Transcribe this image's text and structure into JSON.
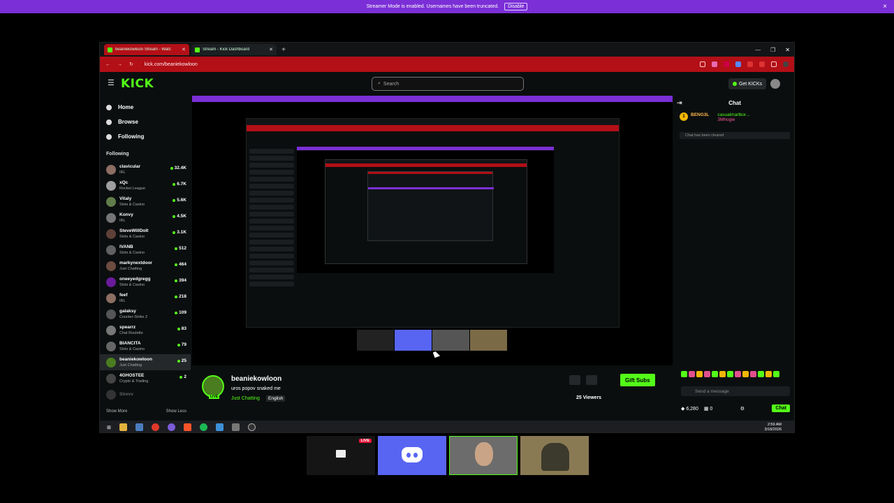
{
  "banner": {
    "text": "Streamer Mode is enabled. Usernames have been truncated.",
    "disable_label": "Disable",
    "close_icon": "×"
  },
  "browser": {
    "tabs": [
      {
        "label": "beaniekowloon Stream - Watc",
        "active": true
      },
      {
        "label": "Stream - Kick Dashboard",
        "active": false
      }
    ],
    "new_tab": "+",
    "url": "kick.com/beaniekowloon",
    "winctl": {
      "min": "—",
      "max": "❐",
      "close": "✕"
    }
  },
  "kick": {
    "logo": "KICK",
    "search_placeholder": "Search",
    "get_kicks": "Get KICKs",
    "nav": [
      {
        "label": "Home",
        "icon": "home-icon"
      },
      {
        "label": "Browse",
        "icon": "compass-icon"
      },
      {
        "label": "Following",
        "icon": "heart-icon"
      }
    ],
    "following_header": "Following",
    "following": [
      {
        "name": "clavicular",
        "cat": "IRL",
        "viewers": "32.4K",
        "color": "#8d6e63"
      },
      {
        "name": "xQc",
        "cat": "Rocket League",
        "viewers": "6.7K",
        "color": "#9e9e9e"
      },
      {
        "name": "Vitaly",
        "cat": "Slots & Casino",
        "viewers": "5.6K",
        "color": "#607d4b"
      },
      {
        "name": "Konvy",
        "cat": "IRL",
        "viewers": "4.5K",
        "color": "#757575"
      },
      {
        "name": "SteveWillDoIt",
        "cat": "Slots & Casino",
        "viewers": "3.1K",
        "color": "#5d4037"
      },
      {
        "name": "IVANB",
        "cat": "Slots & Casino",
        "viewers": "512",
        "color": "#616161"
      },
      {
        "name": "markynextdoor",
        "cat": "Just Chatting",
        "viewers": "464",
        "color": "#6d4c41"
      },
      {
        "name": "oneeyedgregg",
        "cat": "Slots & Casino",
        "viewers": "394",
        "color": "#6a1b9a"
      },
      {
        "name": "feef",
        "cat": "IRL",
        "viewers": "218",
        "color": "#8d6e63"
      },
      {
        "name": "galaksy",
        "cat": "Counter-Strike 2",
        "viewers": "109",
        "color": "#555"
      },
      {
        "name": "spearrz",
        "cat": "Chat Roulette",
        "viewers": "83",
        "color": "#777"
      },
      {
        "name": "BIANCITA",
        "cat": "Slots & Casino",
        "viewers": "79",
        "color": "#666"
      },
      {
        "name": "beaniekowloon",
        "cat": "Just Chatting",
        "viewers": "25",
        "color": "#4a7d1f"
      },
      {
        "name": "4GHOSTEE",
        "cat": "Crypto & Trading",
        "viewers": "2",
        "color": "#444"
      },
      {
        "name": "Strevv",
        "cat": "",
        "viewers": "",
        "color": "#333"
      }
    ],
    "show_more": "Show More",
    "show_less": "Show Less"
  },
  "chat": {
    "title": "Chat",
    "pinned_badge": "1",
    "pinned_user1": "BENG3L",
    "pinned_user2": "casualmarlbor...",
    "pinned_user3": "3Mhogie",
    "cleared": "Chat has been cleared",
    "placeholder": "Send a message",
    "points": "6,280",
    "count": "0",
    "send_label": "Chat"
  },
  "stream": {
    "username": "beaniekowloon",
    "title": "uros popov snaked me",
    "category": "Just Chatting",
    "language": "English",
    "live": "LIVE",
    "gift_label": "Gift Subs",
    "viewers": "25 Viewers"
  },
  "taskbar": {
    "time": "2:59 AM",
    "date": "3/18/2026"
  },
  "bottom_thumbs": {
    "live_badge": "LIVE"
  }
}
